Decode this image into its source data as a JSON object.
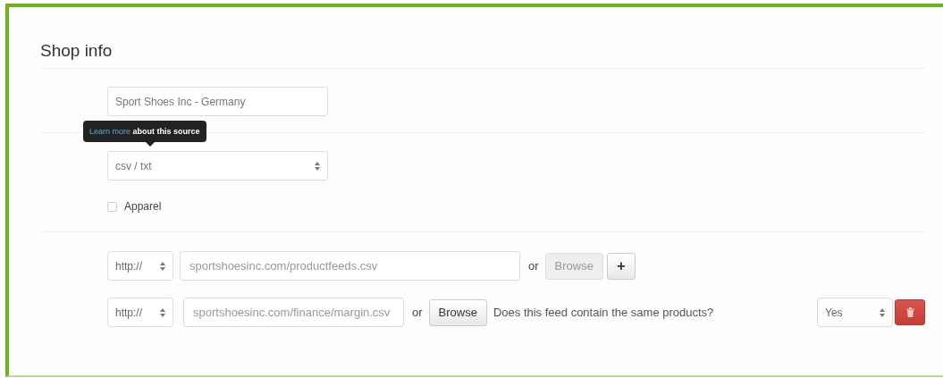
{
  "section": {
    "title": "Shop info"
  },
  "shop_name": {
    "value": "Sport Shoes Inc - Germany"
  },
  "tooltip": {
    "link": "Learn more",
    "text": "about this source"
  },
  "format_select": {
    "value": "csv / txt"
  },
  "apparel_checkbox": {
    "label": "Apparel",
    "checked": false
  },
  "feeds": [
    {
      "kind": "add",
      "protocol": "http://",
      "url": "sportshoesinc.com/productfeeds.csv",
      "or": "or",
      "browse": {
        "label": "Browse",
        "disabled": true
      },
      "add_button": "+"
    },
    {
      "kind": "compare",
      "protocol": "http://",
      "url": "sportshoesinc.com/finance/margin.csv",
      "or": "or",
      "browse": {
        "label": "Browse",
        "disabled": false
      },
      "question": "Does this feed contain the same products?",
      "answer": "Yes"
    }
  ]
}
